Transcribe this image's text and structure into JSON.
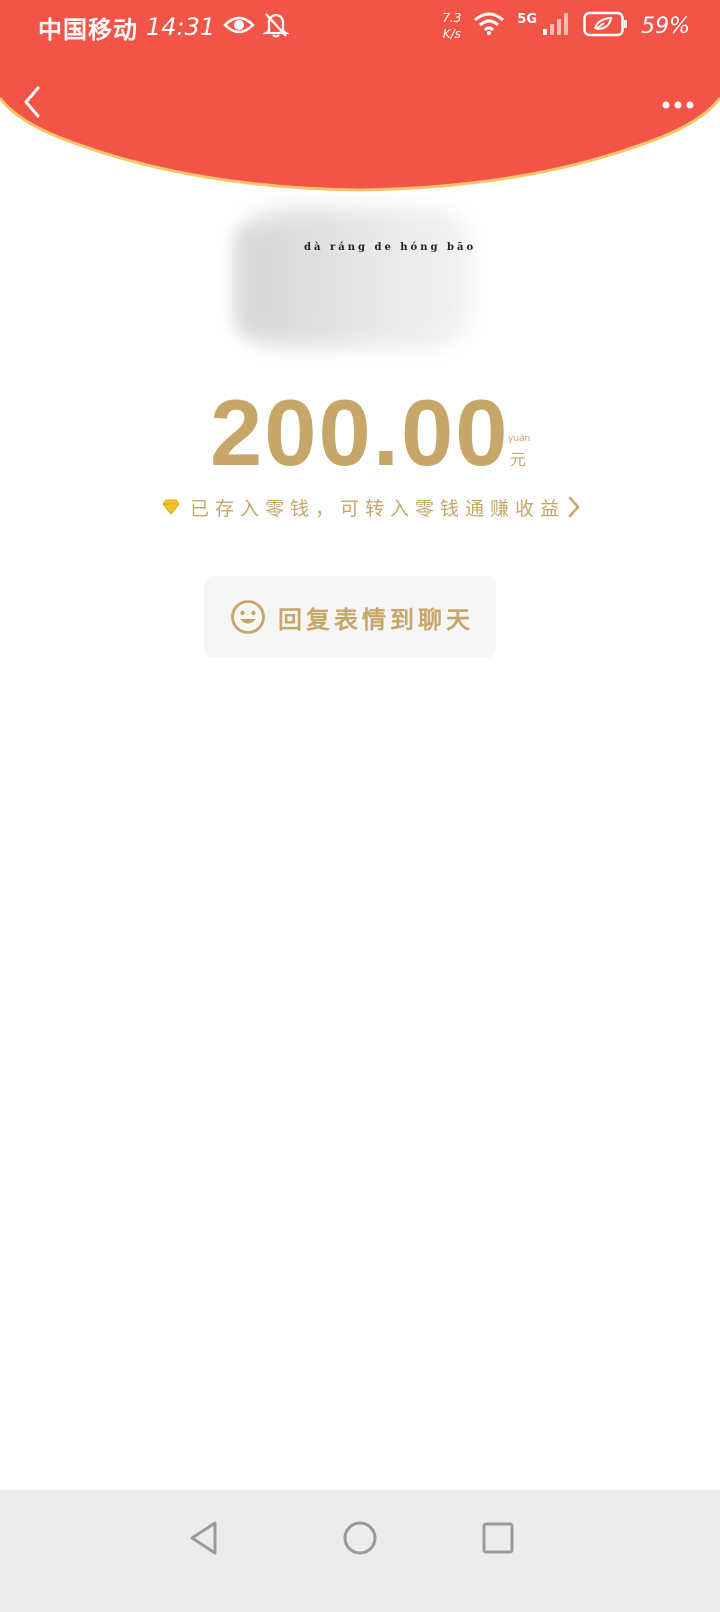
{
  "status_bar": {
    "carrier": "中国移动",
    "time": "14:31",
    "net_speed_value": "7.3",
    "net_speed_unit": "K/s",
    "network": "5G",
    "battery": "59%"
  },
  "sender": {
    "pinyin": "dà ráng de hóng bāo"
  },
  "amount": {
    "value": "200.00",
    "unit": "元",
    "unit_pinyin": "yuán"
  },
  "change_notice": {
    "text": "已存入零钱，可转入零钱通赚收益"
  },
  "reply_button": {
    "label": "回复表情到聊天"
  },
  "colors": {
    "header_red": "#f25548",
    "gold": "#c7a66a",
    "arc_border": "#f7c46a"
  },
  "icons": {
    "back": "chevron-left-icon",
    "more": "more-dots-icon",
    "diamond": "diamond-icon",
    "smile": "smile-icon",
    "nav_back": "triangle-back-icon",
    "nav_home": "circle-home-icon",
    "nav_recent": "square-recent-icon"
  }
}
